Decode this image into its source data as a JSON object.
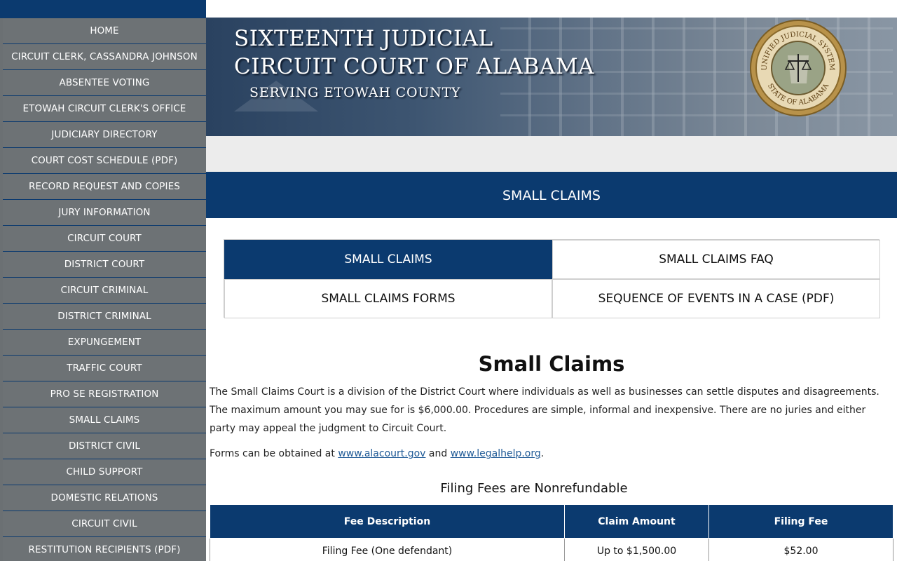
{
  "sidebar": {
    "items": [
      {
        "label": "HOME"
      },
      {
        "label": "CIRCUIT CLERK, CASSANDRA JOHNSON"
      },
      {
        "label": "ABSENTEE VOTING"
      },
      {
        "label": "ETOWAH CIRCUIT CLERK'S OFFICE"
      },
      {
        "label": "JUDICIARY DIRECTORY"
      },
      {
        "label": "COURT COST SCHEDULE (PDF)"
      },
      {
        "label": "RECORD REQUEST AND COPIES"
      },
      {
        "label": "JURY INFORMATION"
      },
      {
        "label": "CIRCUIT COURT"
      },
      {
        "label": "DISTRICT COURT"
      },
      {
        "label": "CIRCUIT CRIMINAL"
      },
      {
        "label": "DISTRICT CRIMINAL"
      },
      {
        "label": "EXPUNGEMENT"
      },
      {
        "label": "TRAFFIC COURT"
      },
      {
        "label": "PRO SE REGISTRATION"
      },
      {
        "label": "SMALL CLAIMS"
      },
      {
        "label": "DISTRICT CIVIL"
      },
      {
        "label": "CHILD SUPPORT"
      },
      {
        "label": "DOMESTIC RELATIONS"
      },
      {
        "label": "CIRCUIT CIVIL"
      },
      {
        "label": "RESTITUTION RECIPIENTS (PDF)"
      }
    ]
  },
  "banner": {
    "line1": "SIXTEENTH JUDICIAL",
    "line2": "CIRCUIT COURT OF ALABAMA",
    "line3": "SERVING ETOWAH COUNTY",
    "seal_top_text": "UNIFIED JUDICIAL SYSTEM",
    "seal_bottom_text": "STATE OF ALABAMA"
  },
  "page_title": "SMALL CLAIMS",
  "tabs": [
    {
      "label": "SMALL CLAIMS",
      "active": true
    },
    {
      "label": "SMALL CLAIMS FAQ",
      "active": false
    },
    {
      "label": "SMALL CLAIMS FORMS",
      "active": false
    },
    {
      "label": "SEQUENCE OF EVENTS IN A CASE (PDF)",
      "active": false
    }
  ],
  "content": {
    "heading": "Small Claims",
    "intro": "The Small Claims Court is a division of the District Court where individuals as well as businesses can settle disputes and disagreements. The maximum amount you may sue for is $6,000.00. Procedures are simple, informal and inexpensive. There are no juries and either party may appeal the judgment to Circuit Court.",
    "forms_prefix": "Forms can be obtained at ",
    "link1": "www.alacourt.gov",
    "forms_and": " and ",
    "link2": "www.legalhelp.org",
    "forms_suffix": ".",
    "fees_heading": "Filing Fees are Nonrefundable"
  },
  "fee_table": {
    "headers": [
      "Fee Description",
      "Claim Amount",
      "Filing Fee"
    ],
    "rows": [
      [
        "Filing Fee (One defendant)",
        "Up to $1,500.00",
        "$52.00"
      ]
    ]
  },
  "colors": {
    "navy": "#0b3a6f",
    "sidebar_gray": "#6d7275",
    "link": "#1f5a96"
  }
}
